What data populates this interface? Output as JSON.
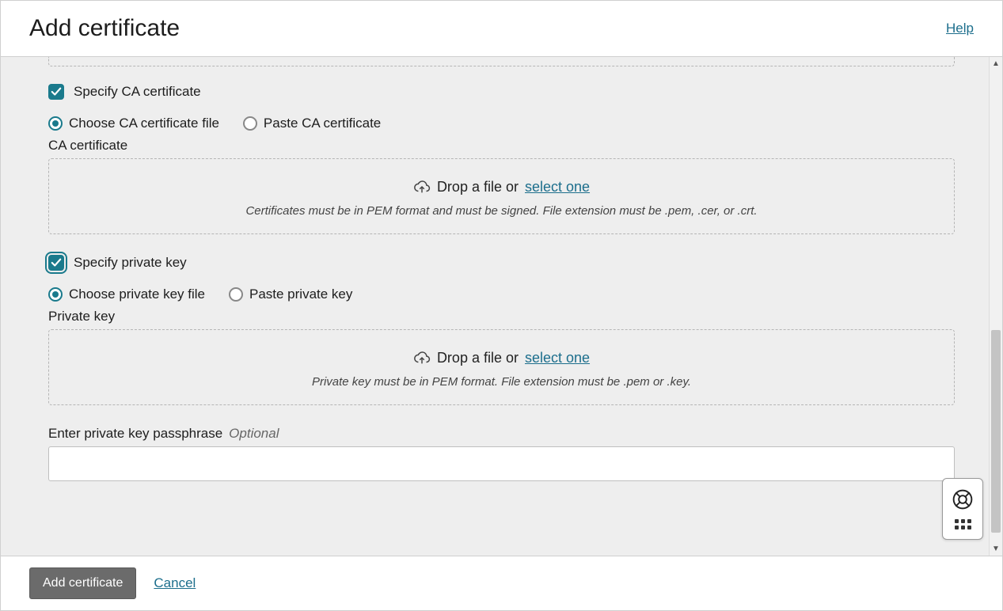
{
  "header": {
    "title": "Add certificate",
    "help": "Help"
  },
  "ca": {
    "specify_label": "Specify CA certificate",
    "radio_choose": "Choose CA certificate file",
    "radio_paste": "Paste CA certificate",
    "section_label": "CA certificate",
    "drop_prefix": "Drop a file or ",
    "drop_link": "select one",
    "drop_hint": "Certificates must be in PEM format and must be signed. File extension must be .pem, .cer, or .crt."
  },
  "pk": {
    "specify_label": "Specify private key",
    "radio_choose": "Choose private key file",
    "radio_paste": "Paste private key",
    "section_label": "Private key",
    "drop_prefix": "Drop a file or ",
    "drop_link": "select one",
    "drop_hint": "Private key must be in PEM format. File extension must be .pem or .key."
  },
  "passphrase": {
    "label": "Enter private key passphrase",
    "optional": "Optional",
    "value": ""
  },
  "footer": {
    "submit": "Add certificate",
    "cancel": "Cancel"
  }
}
